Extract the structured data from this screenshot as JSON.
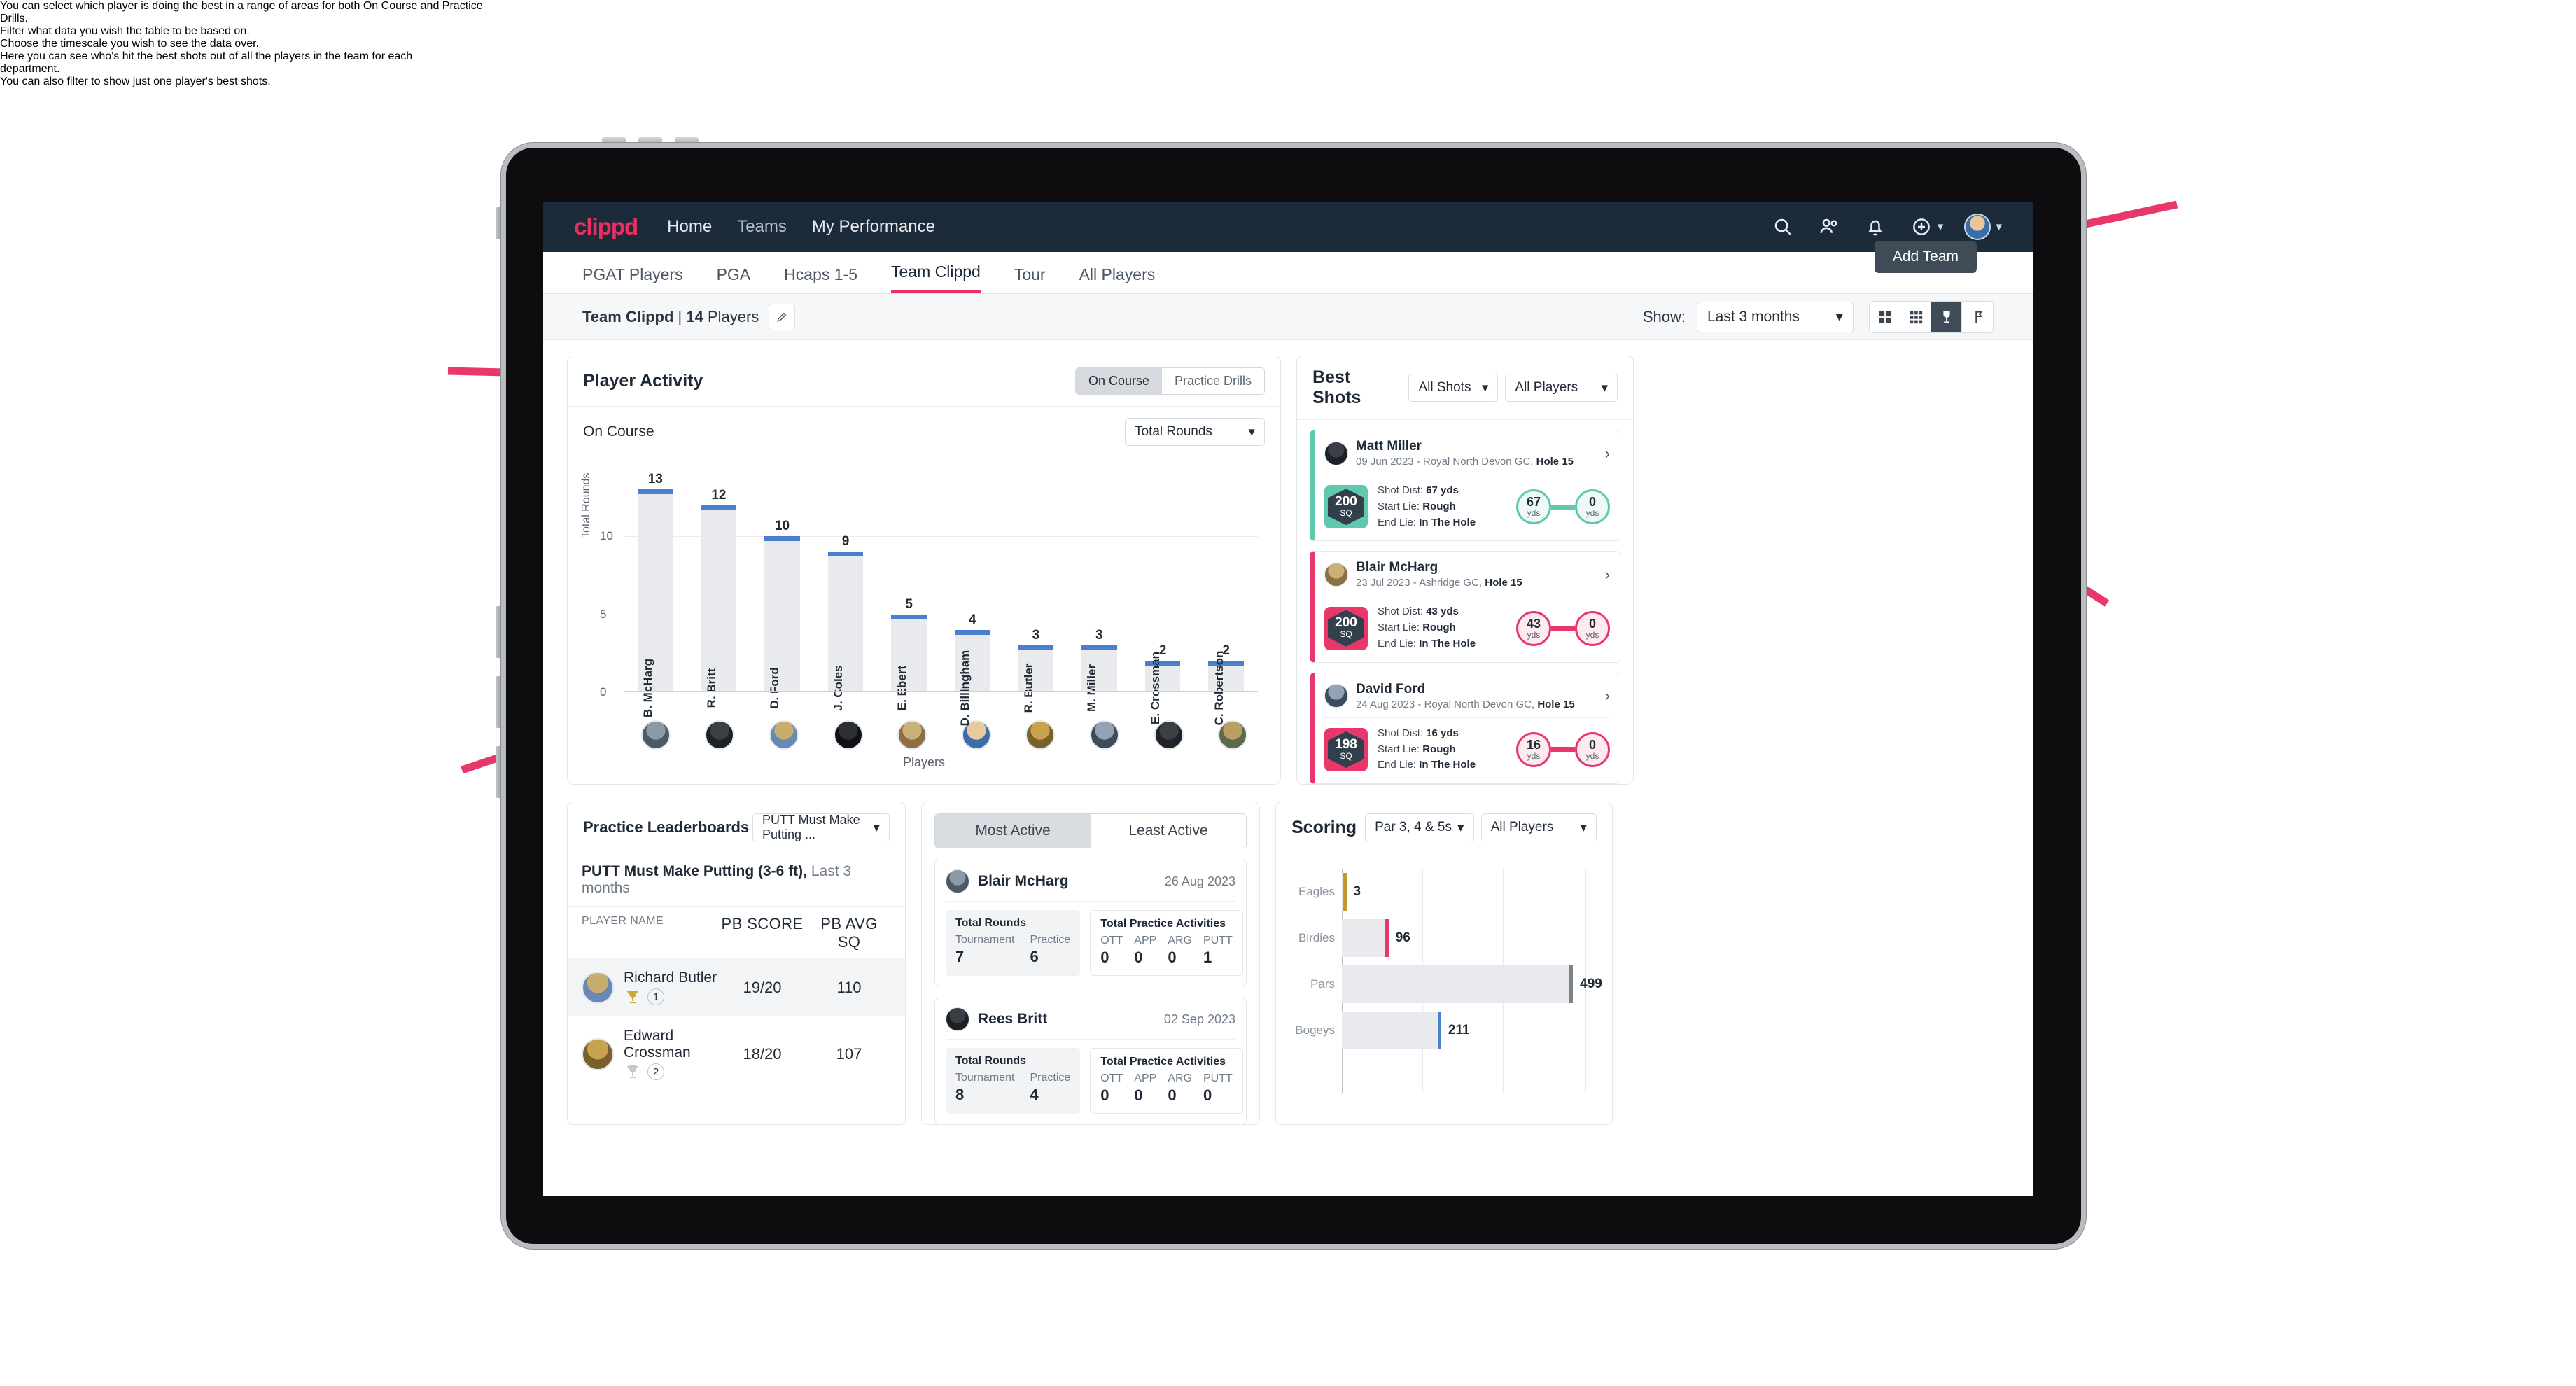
{
  "annotations": {
    "left_top": "You can select which player is doing the best in a range of areas for both On Course and Practice Drills.",
    "left_bottom": "Filter what data you wish the table to be based on.",
    "right_top": "Choose the timescale you wish to see the data over.",
    "right_middle": "Here you can see who's hit the best shots out of all the players in the team for each department.",
    "right_bottom": "You can also filter to show just one player's best shots.",
    "arrow_color": "#e8386b"
  },
  "navbar": {
    "logo": "clippd",
    "links": [
      "Home",
      "Teams",
      "My Performance"
    ],
    "icons": [
      "search-icon",
      "people-icon",
      "bell-icon",
      "plus-circle-icon",
      "avatar-icon"
    ],
    "background": "#1c2b3a",
    "accent": "#ec2f62"
  },
  "tabs": {
    "items": [
      "PGAT Players",
      "PGA",
      "Hcaps 1-5",
      "Team Clippd",
      "Tour",
      "All Players"
    ],
    "active": "Team Clippd",
    "add_team_label": "Add Team"
  },
  "subbar": {
    "team_name": "Team Clippd",
    "team_separator": " | ",
    "player_count": "14",
    "players_word": " Players",
    "edit_icon": "pencil-icon",
    "show_label": "Show:",
    "range_value": "Last 3 months",
    "view_buttons": [
      "grid-large-icon",
      "grid-small-icon",
      "trophy-icon",
      "flag-icon"
    ],
    "active_view": "trophy-icon"
  },
  "player_activity": {
    "title": "Player Activity",
    "segments": [
      "On Course",
      "Practice Drills"
    ],
    "active_segment": "On Course",
    "sub_label": "On Course",
    "metric_select": "Total Rounds"
  },
  "chart_data": {
    "type": "bar",
    "title": "Player Activity - On Course",
    "xlabel": "Players",
    "ylabel": "Total Rounds",
    "categories": [
      "B. McHarg",
      "R. Britt",
      "D. Ford",
      "J. Coles",
      "E. Ebert",
      "D. Billingham",
      "R. Butler",
      "M. Miller",
      "E. Crossman",
      "C. Robertson"
    ],
    "values": [
      13,
      12,
      10,
      9,
      5,
      4,
      3,
      3,
      2,
      2
    ],
    "yticks": [
      0,
      5,
      10
    ],
    "ylim": [
      0,
      14
    ],
    "grid": true,
    "bar_fill": "#e8eaed",
    "bar_cap": "#4a7fd0"
  },
  "best_shots": {
    "title": "Best Shots",
    "shot_filter": "All Shots",
    "player_filter": "All Players",
    "shots": [
      {
        "name": "Matt Miller",
        "meta_date": "09 Jun 2023",
        "meta_course": "Royal North Devon GC,",
        "meta_hole": "Hole 15",
        "sq_value": "200",
        "sq_unit": "SQ",
        "shot_dist_label": "Shot Dist:",
        "shot_dist_value": "67 yds",
        "start_lie_label": "Start Lie:",
        "start_lie_value": "Rough",
        "end_lie_label": "End Lie:",
        "end_lie_value": "In The Hole",
        "from_value": "67",
        "from_unit": "yds",
        "to_value": "0",
        "to_unit": "yds",
        "accent": "#5fc9ae"
      },
      {
        "name": "Blair McHarg",
        "meta_date": "23 Jul 2023",
        "meta_course": "Ashridge GC,",
        "meta_hole": "Hole 15",
        "sq_value": "200",
        "sq_unit": "SQ",
        "shot_dist_label": "Shot Dist:",
        "shot_dist_value": "43 yds",
        "start_lie_label": "Start Lie:",
        "start_lie_value": "Rough",
        "end_lie_label": "End Lie:",
        "end_lie_value": "In The Hole",
        "from_value": "43",
        "from_unit": "yds",
        "to_value": "0",
        "to_unit": "yds",
        "accent": "#e8386b"
      },
      {
        "name": "David Ford",
        "meta_date": "24 Aug 2023",
        "meta_course": "Royal North Devon GC,",
        "meta_hole": "Hole 15",
        "sq_value": "198",
        "sq_unit": "SQ",
        "shot_dist_label": "Shot Dist:",
        "shot_dist_value": "16 yds",
        "start_lie_label": "Start Lie:",
        "start_lie_value": "Rough",
        "end_lie_label": "End Lie:",
        "end_lie_value": "In The Hole",
        "from_value": "16",
        "from_unit": "yds",
        "to_value": "0",
        "to_unit": "yds",
        "accent": "#e8386b"
      }
    ]
  },
  "practice_leaderboards": {
    "title": "Practice Leaderboards",
    "drill_select": "PUTT Must Make Putting ...",
    "sub_title": "PUTT Must Make Putting (3-6 ft),",
    "sub_range": "Last 3 months",
    "columns": [
      "PLAYER NAME",
      "PB SCORE",
      "PB AVG SQ"
    ],
    "rows": [
      {
        "name": "Richard Butler",
        "rank": "1",
        "trophy": "gold",
        "pb_score": "19/20",
        "pb_avg_sq": "110"
      },
      {
        "name": "Edward Crossman",
        "rank": "2",
        "trophy": "silver",
        "pb_score": "18/20",
        "pb_avg_sq": "107"
      }
    ]
  },
  "activity_panel": {
    "tabs": [
      "Most Active",
      "Least Active"
    ],
    "active_tab": "Most Active",
    "rounds_title": "Total Rounds",
    "rounds_cols": [
      "Tournament",
      "Practice"
    ],
    "practice_title": "Total Practice Activities",
    "practice_cols": [
      "OTT",
      "APP",
      "ARG",
      "PUTT"
    ],
    "cards": [
      {
        "name": "Blair McHarg",
        "date": "26 Aug 2023",
        "tournament": "7",
        "practice": "6",
        "ott": "0",
        "app": "0",
        "arg": "0",
        "putt": "1"
      },
      {
        "name": "Rees Britt",
        "date": "02 Sep 2023",
        "tournament": "8",
        "practice": "4",
        "ott": "0",
        "app": "0",
        "arg": "0",
        "putt": "0"
      }
    ]
  },
  "scoring": {
    "title": "Scoring",
    "par_select": "Par 3, 4 & 5s",
    "player_select": "All Players",
    "chart": {
      "type": "bar",
      "orientation": "horizontal",
      "categories": [
        "Eagles",
        "Birdies",
        "Pars",
        "Bogeys"
      ],
      "values": [
        3,
        96,
        499,
        211
      ],
      "colors": [
        "#c3972f",
        "#e8386b",
        "#7b828a",
        "#4a7fd0"
      ],
      "xlim": [
        0,
        560
      ],
      "grid": true
    }
  }
}
